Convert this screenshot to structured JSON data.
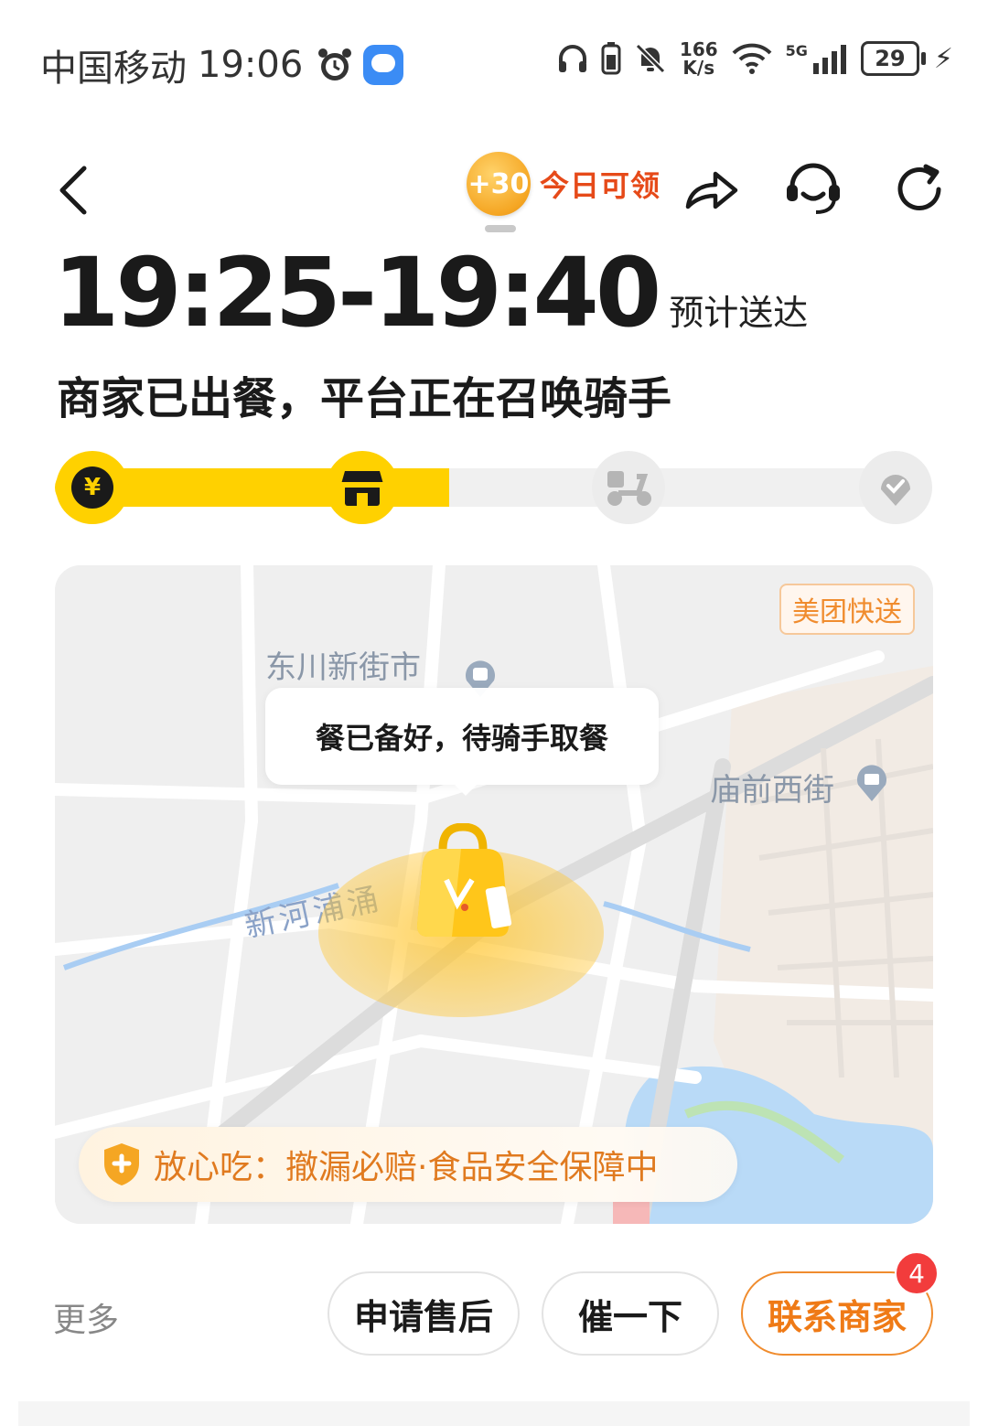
{
  "status_bar": {
    "carrier": "中国移动",
    "time": "19:06",
    "speed_value": "166",
    "speed_unit": "K/s",
    "network": "5G",
    "battery": "29"
  },
  "header": {
    "coin_value": "+30",
    "coin_text": "今日可领"
  },
  "eta": {
    "time_range": "19:25-19:40",
    "label": "预计送达"
  },
  "status_title": "商家已出餐，平台正在召唤骑手",
  "progress": {
    "pay_symbol": "¥",
    "fraction": 0.45
  },
  "map": {
    "brand": "美团快送",
    "place_1": "东川新街市",
    "place_2": "庙前西街",
    "river": "新河浦涌",
    "bubble": "餐已备好，待骑手取餐",
    "safety": "放心吃：撤漏必赔·食品安全保障中"
  },
  "actions": {
    "more": "更多",
    "after_sale": "申请售后",
    "urge": "催一下",
    "contact": "联系商家",
    "contact_badge": "4"
  },
  "colors": {
    "accent_yellow": "#ffd100",
    "accent_orange": "#ef7a16",
    "badge_red": "#f23c3c"
  }
}
